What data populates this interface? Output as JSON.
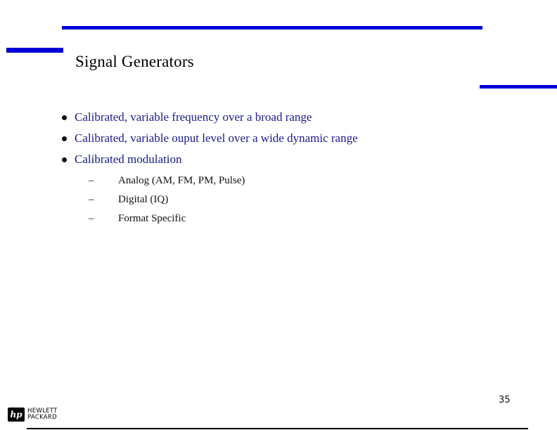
{
  "slide": {
    "title": "Signal Generators",
    "bullets": [
      {
        "text": "Calibrated, variable frequency over a broad range"
      },
      {
        "text": "Calibrated, variable ouput level over a wide dynamic range"
      },
      {
        "text": "Calibrated modulation"
      }
    ],
    "sub_bullets": [
      {
        "marker": "–",
        "text": "Analog (AM, FM, PM, Pulse)"
      },
      {
        "marker": "–",
        "text": "Digital (IQ)"
      },
      {
        "marker": "–",
        "text": "Format Specific"
      }
    ],
    "page_number": "35"
  },
  "footer": {
    "logo_mark": "hp",
    "logo_line1": "HEWLETT",
    "logo_line2": "PACKARD"
  },
  "colors": {
    "accent_bar": "#0000d6",
    "bullet_text": "#1a1a8c"
  }
}
